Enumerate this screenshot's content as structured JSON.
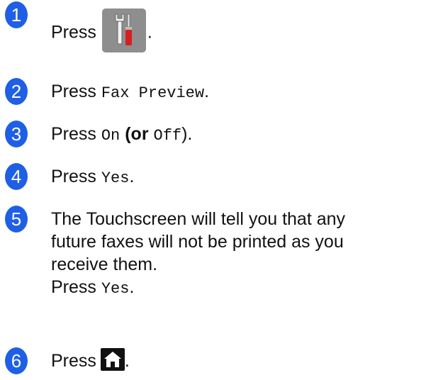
{
  "steps": [
    {
      "number": "1",
      "prefix": "Press",
      "suffix": "."
    },
    {
      "number": "2",
      "prefix": "Press",
      "code": "Fax Preview",
      "suffix": "."
    },
    {
      "number": "3",
      "prefix": "Press",
      "code_on": "On",
      "paren_open": "(",
      "or_word": "or",
      "code_off": "Off",
      "paren_close": ").",
      "suffix": ""
    },
    {
      "number": "4",
      "prefix": "Press",
      "code": "Yes",
      "suffix": "."
    },
    {
      "number": "5",
      "line1": "The Touchscreen will tell you that any",
      "line2": "future faxes will not be printed as you",
      "line3": "receive them.",
      "line4_prefix": "Press",
      "line4_code": "Yes",
      "line4_suffix": "."
    },
    {
      "number": "6",
      "prefix": "Press",
      "suffix": "."
    }
  ],
  "icons": {
    "step1": "settings-tools-icon",
    "step6": "home-icon"
  },
  "colors": {
    "badge": "#1f5fe6",
    "tools_button_bg": "#8e8e8e",
    "screwdriver_handle": "#d81e1e"
  }
}
